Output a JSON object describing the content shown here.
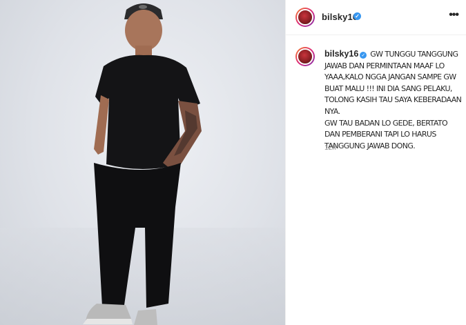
{
  "post": {
    "username": "bilsky16",
    "verified_badge_icon": "verified-check-icon",
    "more_icon": "more-options-icon",
    "caption": {
      "username": "bilsky16",
      "text": "GW TUNGGU TANGGUNG JAWAB DAN PERMINTAAN MAAF LO YAAA,KALO NGGA JANGAN SAMPE GW BUAT MALU !!! INI DIA SANG PELAKU, TOLONG KASIH TAU SAYA KEBERADAAN NYA.\nGW TAU BADAN LO GEDE, BERTATO DAN PEMBERANI TAPI LO HARUS TANGGUNG JAWAB DONG."
    },
    "timestamp": "12h"
  },
  "colors": {
    "verified_blue": "#3897f0",
    "text": "#262626",
    "muted": "#8e8e8e"
  }
}
